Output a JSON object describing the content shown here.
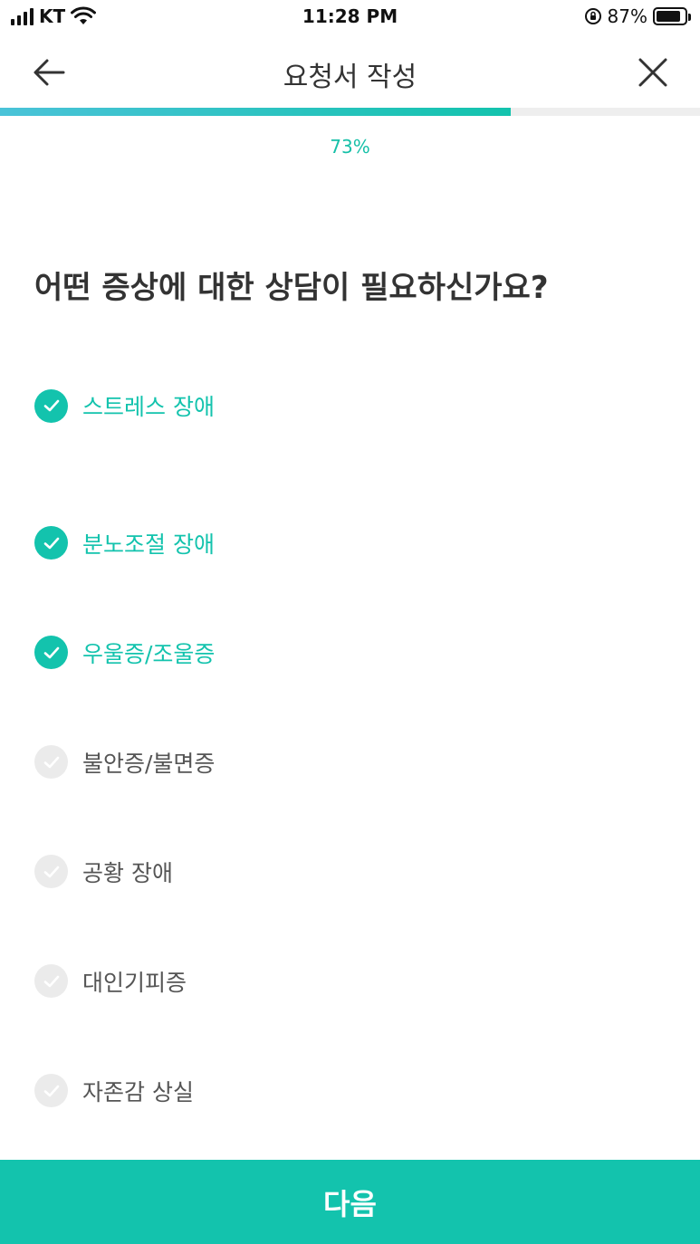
{
  "status_bar": {
    "carrier": "KT",
    "time": "11:28 PM",
    "battery_percent": "87%",
    "battery_level": 0.87
  },
  "header": {
    "title": "요청서 작성",
    "back_icon": "arrow-left-icon",
    "close_icon": "close-icon"
  },
  "progress": {
    "value": 0.73,
    "label": "73%",
    "colors": {
      "start": "#4ac3d8",
      "end": "#13c3ad",
      "track": "#eeeeee"
    }
  },
  "question": "어떤 증상에 대한 상담이 필요하신가요?",
  "options": [
    {
      "label": "스트레스 장애",
      "checked": true
    },
    {
      "label": "분노조절 장애",
      "checked": true
    },
    {
      "label": "우울증/조울증",
      "checked": true
    },
    {
      "label": "불안증/불면증",
      "checked": false
    },
    {
      "label": "공황 장애",
      "checked": false
    },
    {
      "label": "대인기피증",
      "checked": false
    },
    {
      "label": "자존감 상실",
      "checked": false
    }
  ],
  "next_button": {
    "label": "다음"
  },
  "colors": {
    "accent": "#13c3ad",
    "unchecked": "#ebebeb",
    "text": "#333333"
  }
}
